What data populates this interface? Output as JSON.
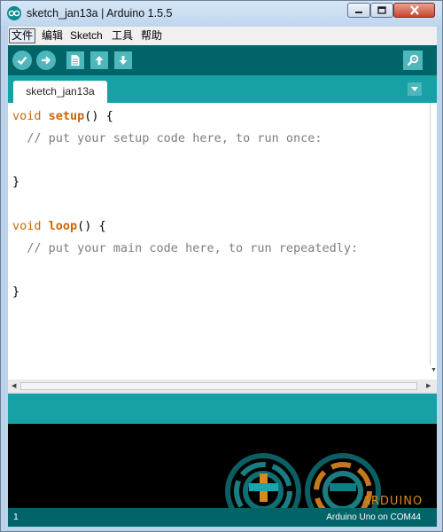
{
  "window": {
    "title": "sketch_jan13a | Arduino 1.5.5"
  },
  "menu": {
    "items": [
      "文件",
      "编辑",
      "Sketch",
      "工具",
      "帮助"
    ]
  },
  "toolbar": {
    "buttons": [
      {
        "name": "verify",
        "icon": "check-icon"
      },
      {
        "name": "upload",
        "icon": "arrow-right-icon"
      },
      {
        "name": "new",
        "icon": "document-icon"
      },
      {
        "name": "open",
        "icon": "arrow-up-icon"
      },
      {
        "name": "save",
        "icon": "arrow-down-icon"
      },
      {
        "name": "serial-monitor",
        "icon": "magnifier-icon"
      }
    ]
  },
  "tabs": [
    {
      "label": "sketch_jan13a",
      "active": true
    }
  ],
  "editor": {
    "lines": [
      "void setup() {",
      "  // put your setup code here, to run once:",
      "",
      "}",
      "",
      "void loop() {",
      "  // put your main code here, to run repeatedly:",
      "",
      "}"
    ],
    "tokens": {
      "void": "void",
      "setup": "setup",
      "loop": "loop",
      "open_1": "() {",
      "open_2": "() {",
      "comment_1": "  // put your setup code here, to run once:",
      "comment_2": "  // put your main code here, to run repeatedly:",
      "close": "}"
    }
  },
  "console": {
    "logo_text": "ARDUINO"
  },
  "footer": {
    "line_number": "1",
    "board": "Arduino Uno on COM44"
  },
  "colors": {
    "toolbar": "#006468",
    "tab_strip": "#17a1a5",
    "button": "#4db7bb",
    "keyword": "#cc6600",
    "comment": "#7e7e7e"
  }
}
